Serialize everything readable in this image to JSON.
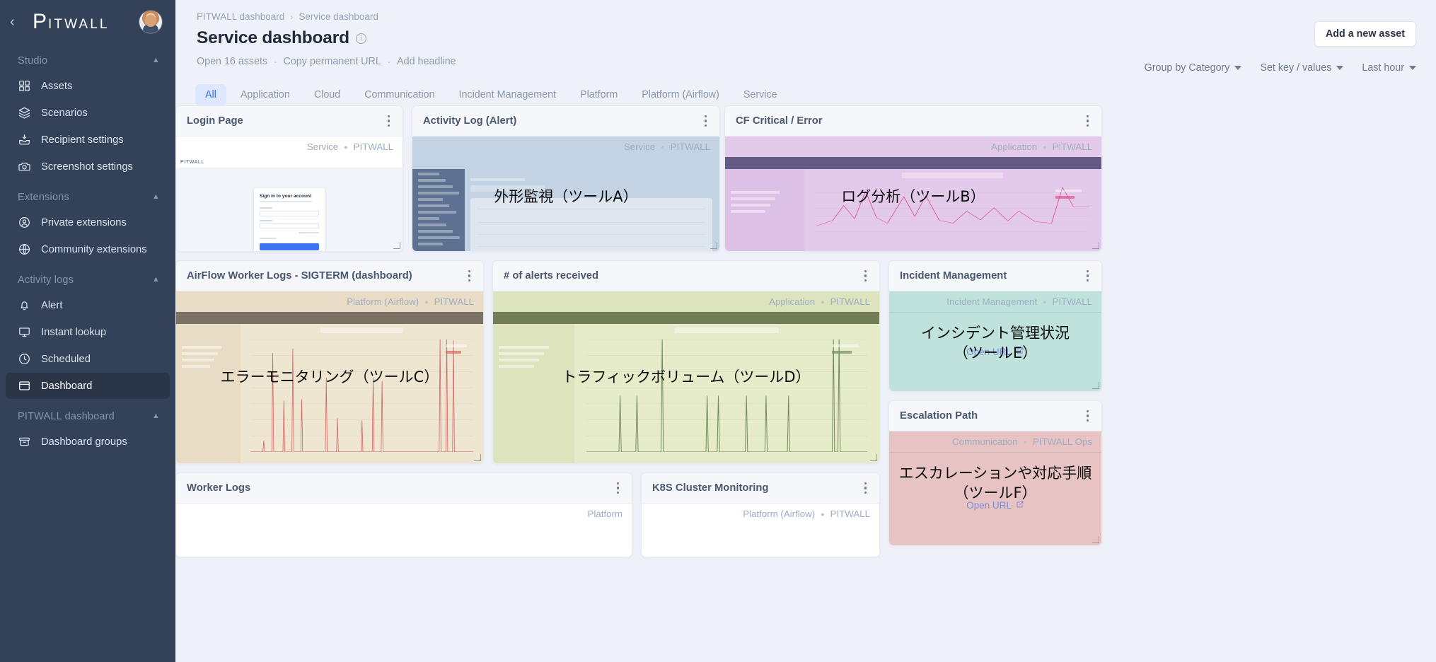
{
  "sidebar": {
    "brand_p": "P",
    "brand_rest": "ITWALL",
    "back_icon": "chevron-left-icon",
    "sections": [
      {
        "label": "Studio",
        "items": [
          {
            "label": "Assets",
            "icon": "grid-icon"
          },
          {
            "label": "Scenarios",
            "icon": "layers-icon"
          },
          {
            "label": "Recipient settings",
            "icon": "inbox-download-icon"
          },
          {
            "label": "Screenshot settings",
            "icon": "camera-icon"
          }
        ]
      },
      {
        "label": "Extensions",
        "items": [
          {
            "label": "Private extensions",
            "icon": "user-circle-icon"
          },
          {
            "label": "Community extensions",
            "icon": "globe-icon"
          }
        ]
      },
      {
        "label": "Activity logs",
        "items": [
          {
            "label": "Alert",
            "icon": "bell-icon"
          },
          {
            "label": "Instant lookup",
            "icon": "monitor-icon"
          },
          {
            "label": "Scheduled",
            "icon": "clock-icon"
          },
          {
            "label": "Dashboard",
            "icon": "window-icon",
            "active": true
          }
        ]
      },
      {
        "label": "PITWALL dashboard",
        "items": [
          {
            "label": "Dashboard groups",
            "icon": "archive-icon"
          }
        ]
      }
    ]
  },
  "header": {
    "breadcrumb": [
      "PITWALL dashboard",
      "Service dashboard"
    ],
    "breadcrumb_sep": "›",
    "title": "Service dashboard",
    "info_icon": "info-icon",
    "sub_actions": [
      "Open 16 assets",
      "Copy permanent URL",
      "Add headline"
    ],
    "sub_action_sep": "·",
    "add_asset_label": "Add a new asset",
    "filters": [
      {
        "label": "Group by Category"
      },
      {
        "label": "Set key / values"
      },
      {
        "label": "Last hour"
      }
    ]
  },
  "tabs": [
    {
      "label": "All",
      "active": true
    },
    {
      "label": "Application"
    },
    {
      "label": "Cloud"
    },
    {
      "label": "Communication"
    },
    {
      "label": "Incident Management"
    },
    {
      "label": "Platform"
    },
    {
      "label": "Platform (Airflow)"
    },
    {
      "label": "Service"
    }
  ],
  "cards": [
    {
      "title": "Login Page",
      "category": "Service",
      "workspace": "PITWALL",
      "overlay": "",
      "accent": "#ffffff"
    },
    {
      "title": "Activity Log (Alert)",
      "category": "Service",
      "workspace": "PITWALL",
      "overlay": "外形監視（ツールA）",
      "accent": "#c3d3e4"
    },
    {
      "title": "CF Critical / Error",
      "category": "Application",
      "workspace": "PITWALL",
      "overlay": "ログ分析（ツールB）",
      "accent": "#e3c9ea"
    },
    {
      "title": "AirFlow Worker Logs - SIGTERM (dashboard)",
      "category": "Platform (Airflow)",
      "workspace": "PITWALL",
      "overlay": "エラーモニタリング（ツールC）",
      "accent": "#e8dcc4"
    },
    {
      "title": "# of alerts received",
      "category": "Application",
      "workspace": "PITWALL",
      "overlay": "トラフィックボリューム（ツールD）",
      "accent": "#dde3bd"
    },
    {
      "title": "Incident Management",
      "category": "Incident Management",
      "workspace": "PITWALL",
      "overlay": "インシデント管理状況\n（ツールE）",
      "overlay_line1": "インシデント管理状況",
      "overlay_line2": "（ツールE）",
      "open_url_label": "Open URL",
      "accent": "#bfe3dc"
    },
    {
      "title": "Escalation Path",
      "category": "Communication",
      "workspace": "PITWALL Ops",
      "overlay_line1": "エスカレーションや対応手順",
      "overlay_line2": "（ツールF）",
      "open_url_label": "Open URL",
      "accent": "#e8c3c3"
    },
    {
      "title": "Worker Logs",
      "category": "Platform",
      "workspace": "",
      "accent": "#ffffff"
    },
    {
      "title": "K8S Cluster Monitoring",
      "category": "Platform (Airflow)",
      "workspace": "PITWALL",
      "accent": "#ffffff"
    }
  ],
  "colors": {
    "sidebar_bg": "#334258",
    "page_bg": "#eef1f7",
    "tab_active_bg": "#dde7fd",
    "tab_active_fg": "#3b72f0",
    "link": "#7b8ed8"
  }
}
